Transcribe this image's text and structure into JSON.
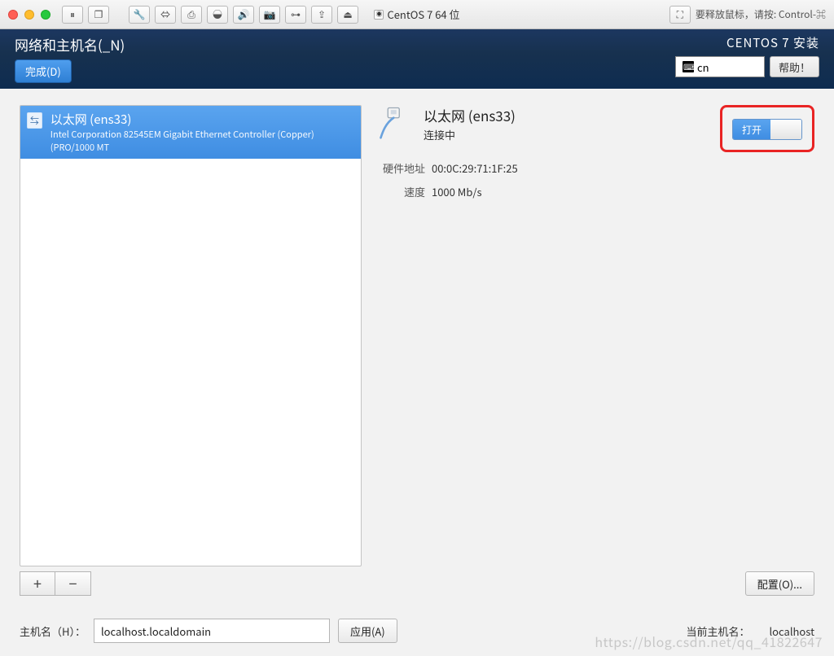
{
  "titlebar": {
    "vm_name": "CentOS 7 64 位",
    "release_hint": "要释放鼠标，请按: Control-⌘"
  },
  "header": {
    "title": "网络和主机名(_N)",
    "done": "完成(D)",
    "install_label": "CENTOS 7 安装",
    "kbd": "cn",
    "help": "帮助！"
  },
  "nic_list": [
    {
      "name": "以太网 (ens33)",
      "desc": "Intel Corporation 82545EM Gigabit Ethernet Controller (Copper) (PRO/1000 MT"
    }
  ],
  "detail": {
    "name": "以太网 (ens33)",
    "status": "连接中",
    "toggle_on_label": "打开",
    "specs": {
      "hwaddr_label": "硬件地址",
      "hwaddr": "00:0C:29:71:1F:25",
      "speed_label": "速度",
      "speed": "1000 Mb/s"
    },
    "config_btn": "配置(O)..."
  },
  "bottom": {
    "hostname_label": "主机名（H）：",
    "hostname_value": "localhost.localdomain",
    "apply": "应用(A)",
    "current_label": "当前主机名：",
    "current_value": "localhost"
  },
  "watermark": "https://blog.csdn.net/qq_41822647"
}
